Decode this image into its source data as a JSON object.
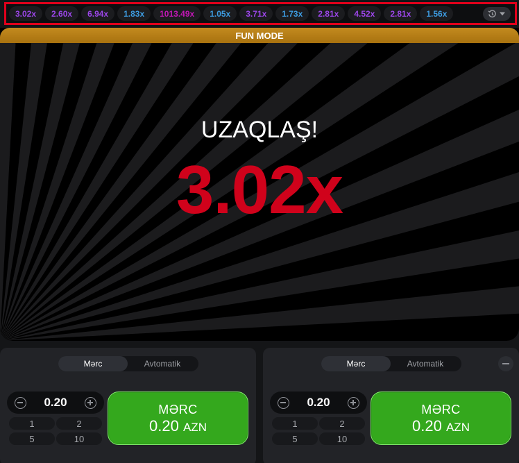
{
  "history": {
    "items": [
      {
        "value": "3.02x",
        "color": "#9b46e8"
      },
      {
        "value": "2.60x",
        "color": "#9b46e8"
      },
      {
        "value": "6.94x",
        "color": "#9b46e8"
      },
      {
        "value": "1.83x",
        "color": "#3d9be0"
      },
      {
        "value": "1013.49x",
        "color": "#c017b4"
      },
      {
        "value": "1.05x",
        "color": "#3d9be0"
      },
      {
        "value": "3.71x",
        "color": "#9b46e8"
      },
      {
        "value": "1.73x",
        "color": "#3d9be0"
      },
      {
        "value": "2.81x",
        "color": "#9b46e8"
      },
      {
        "value": "4.52x",
        "color": "#9b46e8"
      },
      {
        "value": "2.81x",
        "color": "#9b46e8"
      },
      {
        "value": "1.56x",
        "color": "#3d9be0"
      }
    ],
    "toggle_icons": [
      "history-icon",
      "caret-down-icon"
    ]
  },
  "game": {
    "fun_mode_label": "FUN MODE",
    "flew_away_label": "UZAQLAŞ!",
    "multiplier": "3.02x",
    "multiplier_color": "#d0021b",
    "banner_color": "#b27d16"
  },
  "panels": [
    {
      "tabs": {
        "bet": "Mərc",
        "auto": "Avtomatik"
      },
      "amount": "0.20",
      "quick_amounts": [
        "1",
        "2",
        "5",
        "10"
      ],
      "bet_button": {
        "label": "MƏRC",
        "amount": "0.20",
        "currency": "AZN"
      },
      "has_remove": false
    },
    {
      "tabs": {
        "bet": "Mərc",
        "auto": "Avtomatik"
      },
      "amount": "0.20",
      "quick_amounts": [
        "1",
        "2",
        "5",
        "10"
      ],
      "bet_button": {
        "label": "MƏRC",
        "amount": "0.20",
        "currency": "AZN"
      },
      "has_remove": true
    }
  ],
  "colors": {
    "bet_green": "#34a81d",
    "history_frame": "#e0001b"
  }
}
